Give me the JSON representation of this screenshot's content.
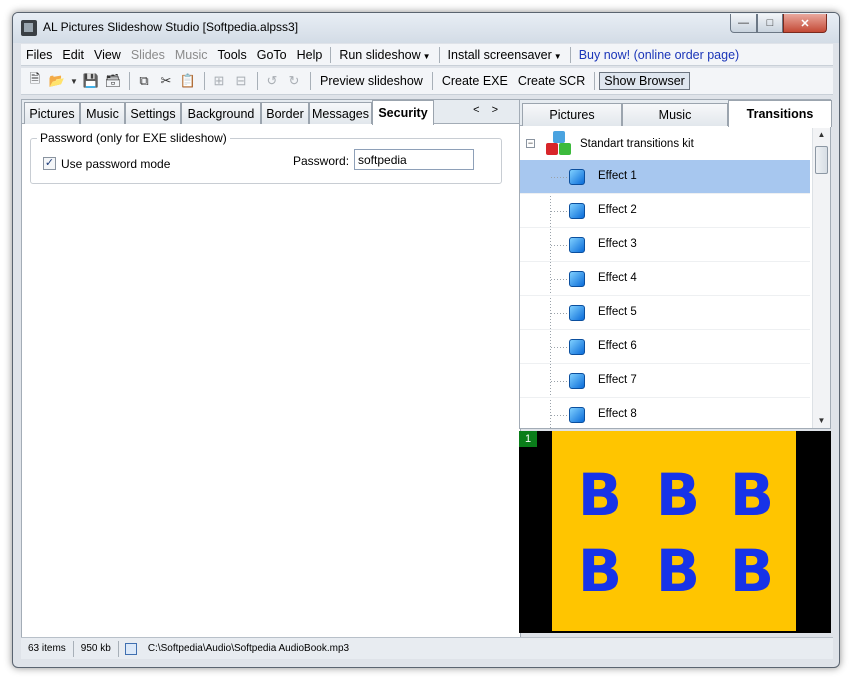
{
  "window": {
    "title": "AL Pictures Slideshow Studio [Softpedia.alpss3]"
  },
  "menubar": {
    "items": [
      "Files",
      "Edit",
      "View",
      "Slides",
      "Music",
      "Tools",
      "GoTo",
      "Help"
    ],
    "disabled": [
      "Slides",
      "Music"
    ],
    "run_slideshow": "Run slideshow",
    "install_screensaver": "Install screensaver",
    "buy_now": "Buy now! (online order page)"
  },
  "toolbar": {
    "icons": [
      "new-icon",
      "open-icon",
      "dropdown-icon",
      "save-icon",
      "save-all-icon",
      "copy-icon",
      "cut-icon",
      "paste-icon",
      "add-slide-icon",
      "remove-slide-icon",
      "rotate-left-icon",
      "rotate-right-icon"
    ],
    "preview_slideshow": "Preview slideshow",
    "create_exe": "Create EXE",
    "create_scr": "Create SCR",
    "show_browser": "Show Browser"
  },
  "left_tabs": {
    "tabs": [
      "Pictures",
      "Music",
      "Settings",
      "Background",
      "Border",
      "Messages",
      "Security"
    ],
    "active": "Security"
  },
  "security": {
    "group_label": "Password (only for EXE slideshow)",
    "use_password_label": "Use password mode",
    "use_password_checked": true,
    "password_label": "Password:",
    "password_value": "softpedia"
  },
  "right_tabs": {
    "tabs": [
      "Pictures",
      "Music",
      "Transitions"
    ],
    "active": "Transitions"
  },
  "transitions": {
    "kit_label": "Standart transitions kit",
    "effects": [
      "Effect 1",
      "Effect 2",
      "Effect 3",
      "Effect 4",
      "Effect 5",
      "Effect 6",
      "Effect 7",
      "Effect 8"
    ],
    "selected_index": 0
  },
  "preview": {
    "frame_number": "1",
    "letters": [
      "B",
      "B",
      "B",
      "B",
      "B",
      "B"
    ],
    "colors": {
      "background": "#ffc500",
      "letter": "#1733e8",
      "frame_badge": "#0a7d1a"
    }
  },
  "statusbar": {
    "items_count": "63 items",
    "size": "950 kb",
    "file_path": "C:\\Softpedia\\Audio\\Softpedia AudioBook.mp3"
  },
  "colors": {
    "selection": "#a7c7ef",
    "link": "#1a35b8"
  }
}
